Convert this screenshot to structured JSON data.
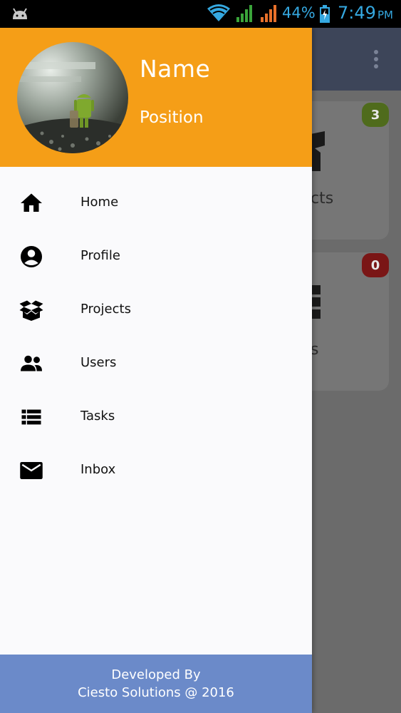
{
  "status_bar": {
    "battery_percent": "44%",
    "time": "7:49",
    "ampm": "PM",
    "icons": [
      "android-icon",
      "wifi-icon",
      "signal-icon",
      "signal-icon",
      "battery-charging-icon"
    ],
    "accent_color": "#35a8e0"
  },
  "background_app": {
    "toolbar_color": "#3d4559",
    "cards": [
      {
        "label": "cts",
        "badge": "3",
        "badge_color": "#4f6b1c"
      },
      {
        "label": "s",
        "badge": "0",
        "badge_color": "#7a1616"
      }
    ]
  },
  "drawer": {
    "header": {
      "name": "Name",
      "position": "Position",
      "background_color": "#f59e17"
    },
    "items": [
      {
        "label": "Home",
        "icon": "home-icon"
      },
      {
        "label": "Profile",
        "icon": "account-circle-icon"
      },
      {
        "label": "Projects",
        "icon": "open-box-icon"
      },
      {
        "label": "Users",
        "icon": "people-icon"
      },
      {
        "label": "Tasks",
        "icon": "list-icon"
      },
      {
        "label": "Inbox",
        "icon": "mail-icon"
      }
    ],
    "footer": {
      "line1": "Developed By",
      "line2": "Ciesto Solutions @ 2016",
      "background_color": "#6b8ac9"
    }
  }
}
